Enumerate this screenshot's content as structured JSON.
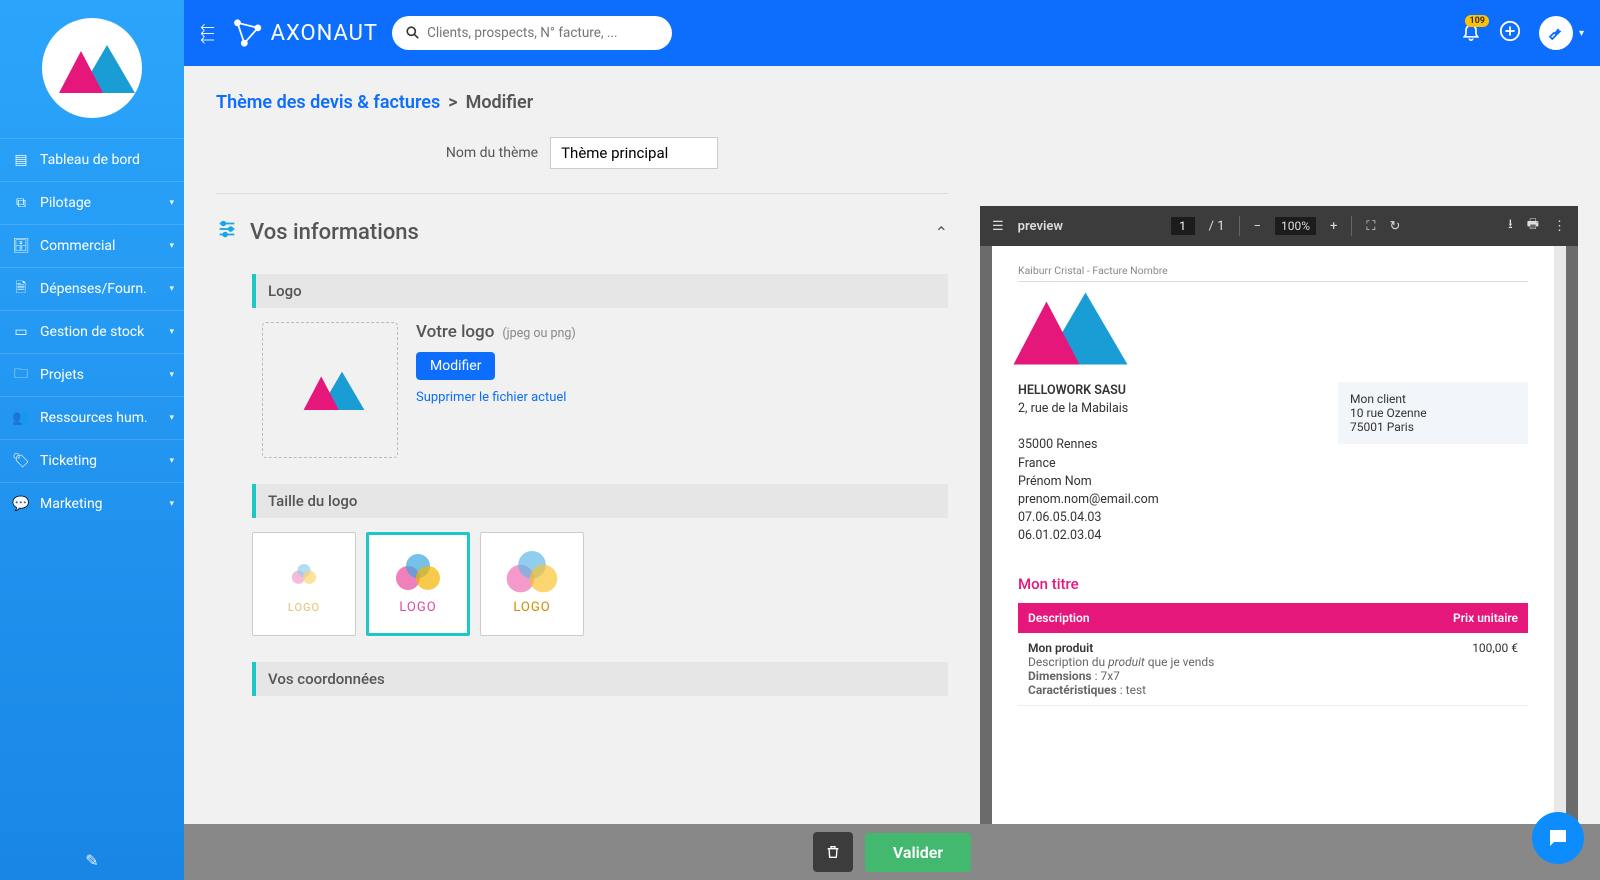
{
  "brand": "AXONAUT",
  "search": {
    "placeholder": "Clients, prospects, N° facture, ..."
  },
  "notifications": {
    "count": "109"
  },
  "sidebar": {
    "items": [
      {
        "label": "Tableau de bord"
      },
      {
        "label": "Pilotage"
      },
      {
        "label": "Commercial"
      },
      {
        "label": "Dépenses/Fourn."
      },
      {
        "label": "Gestion de stock"
      },
      {
        "label": "Projets"
      },
      {
        "label": "Ressources hum."
      },
      {
        "label": "Ticketing"
      },
      {
        "label": "Marketing"
      }
    ]
  },
  "breadcrumb": {
    "parent": "Thème des devis & factures",
    "sep": ">",
    "current": "Modifier"
  },
  "theme_name": {
    "label": "Nom du thème",
    "value": "Thème principal"
  },
  "section_info": {
    "title": "Vos informations"
  },
  "logo_block": {
    "heading": "Logo",
    "title": "Votre logo",
    "hint": "(jpeg ou png)",
    "modify": "Modifier",
    "delete": "Supprimer le fichier actuel"
  },
  "size_block": {
    "heading": "Taille du logo",
    "label": "LOGO"
  },
  "coords_block": {
    "heading": "Vos coordonnées"
  },
  "preview": {
    "label": "preview",
    "page_current": "1",
    "page_total": "/  1",
    "zoom": "100%",
    "header": "Kaiburr Cristal - Facture Nombre",
    "client": {
      "name": "Mon client",
      "street": "10 rue Ozenne",
      "city": "75001 Paris"
    },
    "company": {
      "name": "HELLOWORK SASU",
      "street": "2, rue de la Mabilais",
      "city": "35000 Rennes",
      "country": "France",
      "contact": "Prénom Nom",
      "email": "prenom.nom@email.com",
      "phone1": "07.06.05.04.03",
      "phone2": "06.01.02.03.04"
    },
    "doc_title": "Mon titre",
    "table": {
      "col_desc": "Description",
      "col_price": "Prix unitaire",
      "row": {
        "product": "Mon produit",
        "desc_pre": "Description du ",
        "desc_em": "produit",
        "desc_post": " que je vends",
        "dims_label": "Dimensions",
        "dims_val": " : 7x7",
        "chars_label": "Caractéristiques",
        "chars_val": " : test",
        "price": "100,00 €"
      }
    }
  },
  "footer": {
    "validate": "Valider"
  }
}
